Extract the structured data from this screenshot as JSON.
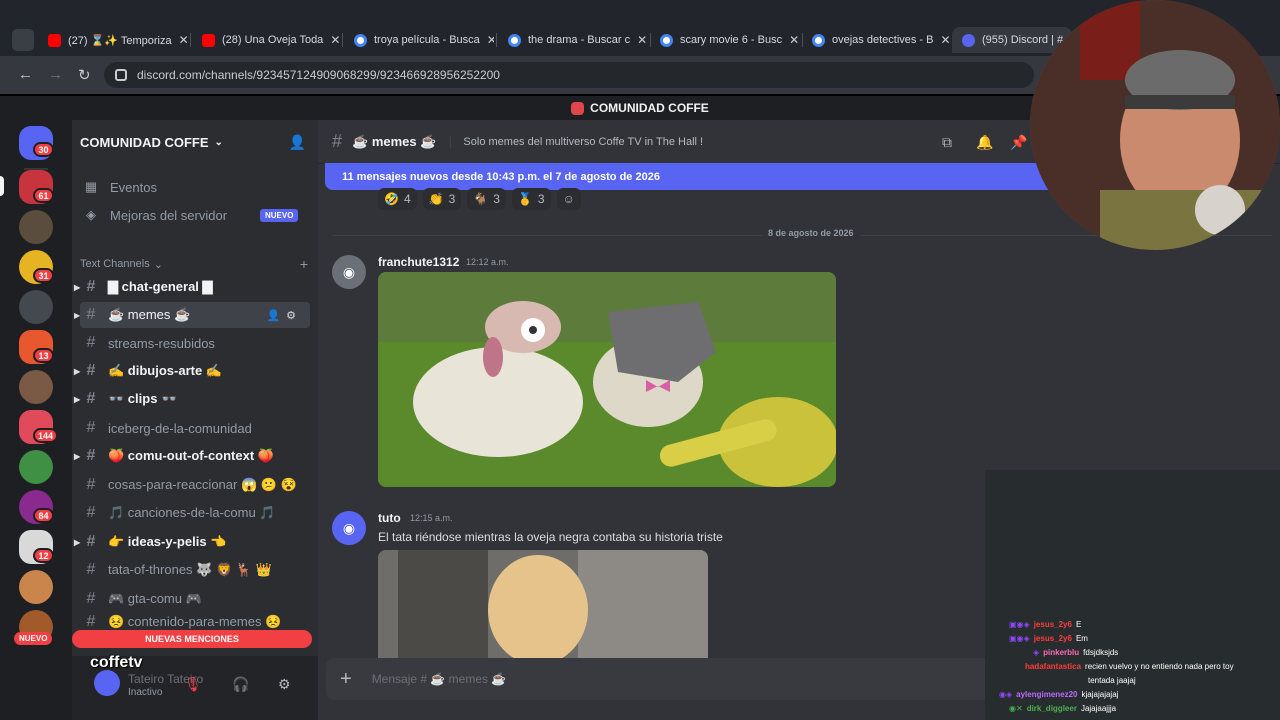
{
  "browser": {
    "tabs": [
      {
        "title": "(27) ⌛✨ Temporiza",
        "icon": "youtube-icon"
      },
      {
        "title": "(28) Una Oveja Toda",
        "icon": "youtube-icon"
      },
      {
        "title": "troya película - Busca",
        "icon": "google-icon"
      },
      {
        "title": "the drama - Buscar c",
        "icon": "google-icon"
      },
      {
        "title": "scary movie 6 - Busc",
        "icon": "google-icon"
      },
      {
        "title": "ovejas detectives - B",
        "icon": "google-icon"
      },
      {
        "title": "(955) Discord | #",
        "icon": "discord-icon",
        "active": true
      }
    ],
    "url": "discord.com/channels/923457124909068299/923466928956252200"
  },
  "discord": {
    "server_title": "COMUNIDAD COFFE",
    "server_name": "COMUNIDAD COFFE",
    "guild_badges": [
      "30",
      "61",
      "31",
      "13",
      "144",
      "84",
      "12"
    ],
    "misc": [
      {
        "label": "Eventos",
        "icon": "calendar-icon"
      },
      {
        "label": "Mejoras del servidor",
        "icon": "boost-icon",
        "badge": "NUEVO"
      }
    ],
    "category": "Text Channels",
    "channels": [
      {
        "name": "▇ chat-general ▇",
        "unread": true,
        "arrow": true
      },
      {
        "name": "☕ memes ☕",
        "selected": true,
        "arrow": true
      },
      {
        "name": "streams-resubidos"
      },
      {
        "name": "✍ dibujos-arte ✍",
        "unread": true,
        "arrow": true
      },
      {
        "name": "👓 clips 👓",
        "unread": true,
        "arrow": true
      },
      {
        "name": "iceberg-de-la-comunidad"
      },
      {
        "name": "🍑 comu-out-of-context 🍑",
        "unread": true,
        "arrow": true
      },
      {
        "name": "cosas-para-reaccionar 😱 😕 😵"
      },
      {
        "name": "🎵 canciones-de-la-comu 🎵"
      },
      {
        "name": "👉 ideas-y-pelis 👈",
        "unread": true,
        "arrow": true
      },
      {
        "name": "tata-of-thrones 🐺 🦁 🦌 👑"
      },
      {
        "name": "🎮 gta-comu 🎮"
      },
      {
        "name": "😣 contenido-para-memes 😣"
      }
    ],
    "new_label": "NUEVO",
    "mentions_label": "NUEVAS MENCIONES",
    "user": {
      "name": "Tateiro Tateiro",
      "status": "Inactivo"
    },
    "overlay_logo": "coffetv",
    "channel": {
      "name": "☕ memes ☕",
      "topic": "Solo memes del multiverso Coffe TV in The Hall !"
    },
    "new_messages_bar": "11 mensajes nuevos desde 10:43 p.m. el 7 de agosto de 2026",
    "reactions": [
      {
        "emoji": "🤣",
        "count": "4"
      },
      {
        "emoji": "👏",
        "count": "3"
      },
      {
        "emoji": "🐐",
        "count": "3"
      },
      {
        "emoji": "🥇",
        "count": "3"
      },
      {
        "emoji": "☺",
        "count": ""
      }
    ],
    "date_divider": "8 de agosto de 2026",
    "messages": [
      {
        "author": "franchute1312",
        "time": "12:12 a.m.",
        "text": ""
      },
      {
        "author": "tuto",
        "time": "12:15 a.m.",
        "text": "El tata riéndose mientras la oveja negra contaba su historia triste"
      }
    ],
    "composer_placeholder": "Mensaje # ☕ memes ☕"
  },
  "stream_chat": [
    {
      "user": "jesus_2y6",
      "msg": "E",
      "color": "#ff3b3b"
    },
    {
      "user": "jesus_2y6",
      "msg": "Em",
      "color": "#ff3b3b"
    },
    {
      "user": "pinkerblu",
      "msg": "fdsjdksjds",
      "color": "#ff69b4"
    },
    {
      "user": "hadafantastica",
      "msg": "recien vuelvo y no entiendo nada pero toy",
      "color": "#ff3b3b"
    },
    {
      "user": "",
      "msg": "tentada jaajaj",
      "color": "#ffffff"
    },
    {
      "user": "aylengimenez20",
      "msg": "kjajajajajaj",
      "color": "#b86bff"
    },
    {
      "user": "dirk_diggleer",
      "msg": "Jajajaajjja",
      "color": "#4caf50"
    }
  ]
}
